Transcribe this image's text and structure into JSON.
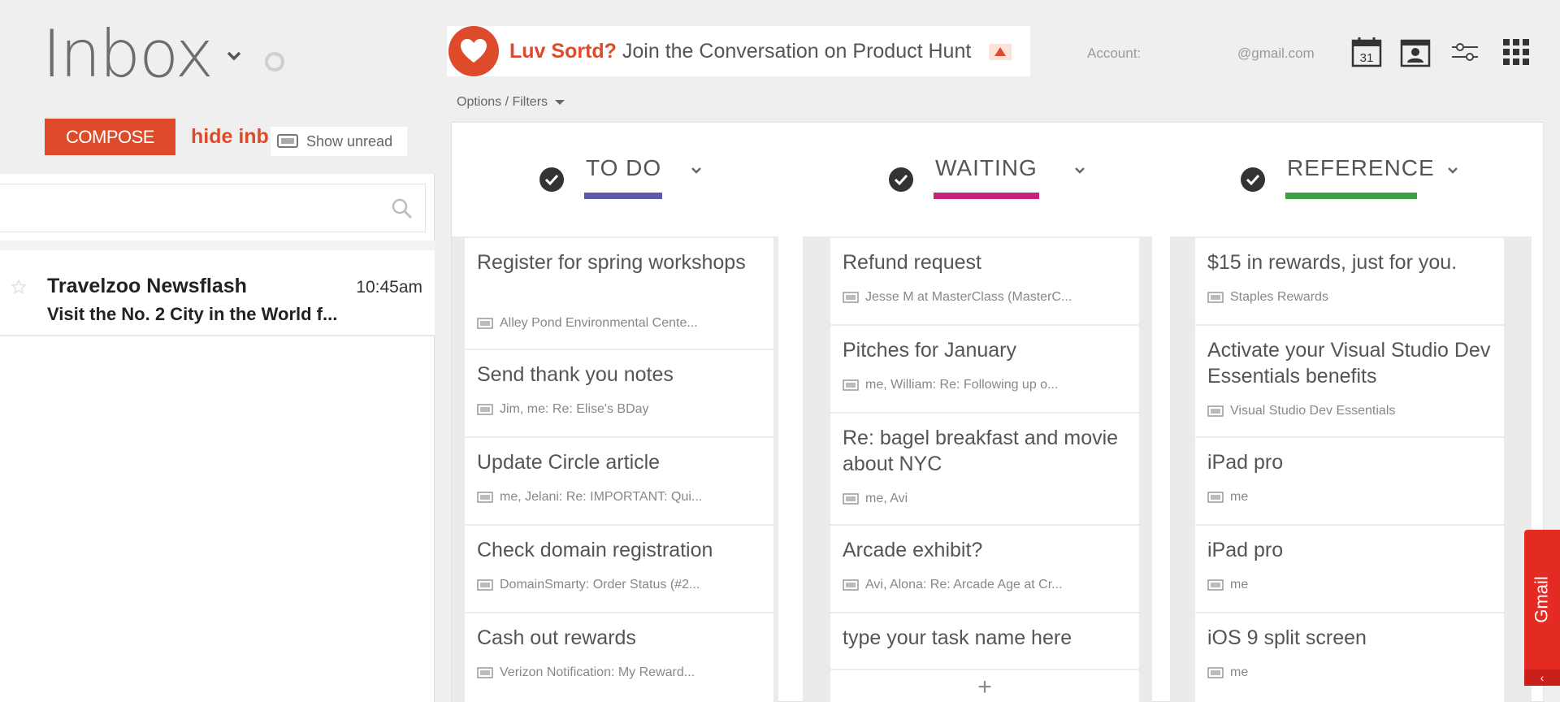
{
  "header": {
    "title": "Inbox",
    "compose_label": "COMPOSE",
    "hide_inbox_label": "hide inb",
    "show_unread_label": "Show unread"
  },
  "search": {
    "placeholder": ""
  },
  "emails": [
    {
      "sender": "Travelzoo Newsflash",
      "time": "10:45am",
      "subject": "Visit the No. 2 City in the World f..."
    }
  ],
  "banner": {
    "brand": "Luv Sortd?",
    "text": "Join the Conversation on Product Hunt"
  },
  "account": {
    "label": "Account:",
    "email": "@gmail.com"
  },
  "options_label": "Options / Filters",
  "columns": [
    {
      "title": "TO DO",
      "color": "#5c5aa8",
      "tasks": [
        {
          "title": "Register for spring workshops",
          "meta": "Alley Pond Environmental Cente..."
        },
        {
          "title": "Send thank you notes",
          "meta": "Jim, me: Re: Elise's BDay"
        },
        {
          "title": "Update Circle article",
          "meta": "me, Jelani: Re: IMPORTANT: Qui..."
        },
        {
          "title": "Check domain registration",
          "meta": "DomainSmarty: Order Status (#2..."
        },
        {
          "title": "Cash out rewards",
          "meta": "Verizon Notification: My Reward..."
        }
      ]
    },
    {
      "title": "WAITING",
      "color": "#c2267a",
      "tasks": [
        {
          "title": "Refund request",
          "meta": "Jesse M at MasterClass (MasterC..."
        },
        {
          "title": "Pitches for January",
          "meta": "me, William: Re: Following up o..."
        },
        {
          "title": "Re: bagel breakfast and movie about NYC",
          "meta": "me, Avi"
        },
        {
          "title": "Arcade exhibit?",
          "meta": "Avi, Alona: Re: Arcade Age at Cr..."
        }
      ],
      "new_task_placeholder": "type your task name here",
      "add_label": "+"
    },
    {
      "title": "REFERENCE",
      "color": "#3aa047",
      "tasks": [
        {
          "title": "$15 in rewards, just for you.",
          "meta": "Staples Rewards"
        },
        {
          "title": "Activate your Visual Studio Dev Essentials benefits",
          "meta": "Visual Studio Dev Essentials"
        },
        {
          "title": "iPad pro",
          "meta": "me"
        },
        {
          "title": "iPad pro",
          "meta": "me"
        },
        {
          "title": "iOS 9 split screen",
          "meta": "me"
        }
      ]
    }
  ],
  "gmail_tab": {
    "label": "Gmail",
    "arrow": "‹"
  },
  "accent": "#dd4b2a"
}
